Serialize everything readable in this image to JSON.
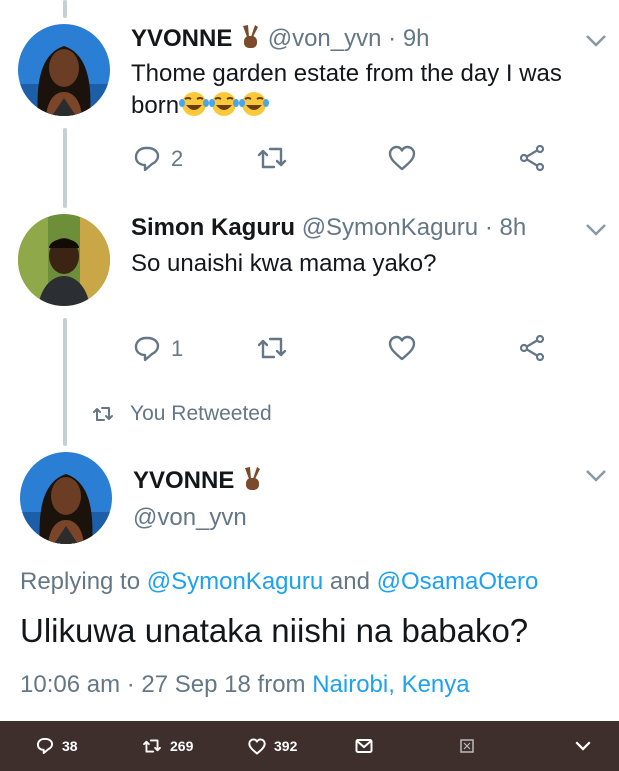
{
  "tweets": [
    {
      "name": "YVONNE",
      "handle": "@von_yvn",
      "dot": "·",
      "time": "9h",
      "text_line1": "Thome garden estate from the day I was",
      "text_line2": "born",
      "emoji": [
        "😂",
        "😂",
        "😂"
      ],
      "reply_count": "2",
      "retweet_count": "",
      "like_count": ""
    },
    {
      "name": "Simon Kaguru",
      "handle": "@SymonKaguru",
      "dot": "·",
      "time": "8h",
      "text_line1": "So unaishi kwa mama yako?",
      "reply_count": "1",
      "retweet_count": "",
      "like_count": ""
    }
  ],
  "retweet_notice": "You Retweeted",
  "main_tweet": {
    "name": "YVONNE",
    "handle": "@von_yvn",
    "replying_prefix": "Replying to",
    "reply_to_1": "@SymonKaguru",
    "reply_and": "and",
    "reply_to_2": "@OsamaOtero",
    "text": "Ulikuwa unataka niishi na babako?",
    "time": "10:06 am",
    "dot": "·",
    "date": "27 Sep 18",
    "from_label": "from",
    "location": "Nairobi, Kenya"
  },
  "bottom_bar": {
    "replies": "38",
    "retweets": "269",
    "likes": "392"
  },
  "colors": {
    "accent": "#1da1f2",
    "secondary_text": "#657786",
    "bar_bg": "#3f2f2c",
    "thread_line": "#c4cfd6"
  },
  "icons": [
    "chevron-down-icon",
    "reply-icon",
    "retweet-icon",
    "like-icon",
    "share-icon",
    "mail-icon",
    "victory-hand-icon",
    "tears-of-joy-emoji"
  ]
}
